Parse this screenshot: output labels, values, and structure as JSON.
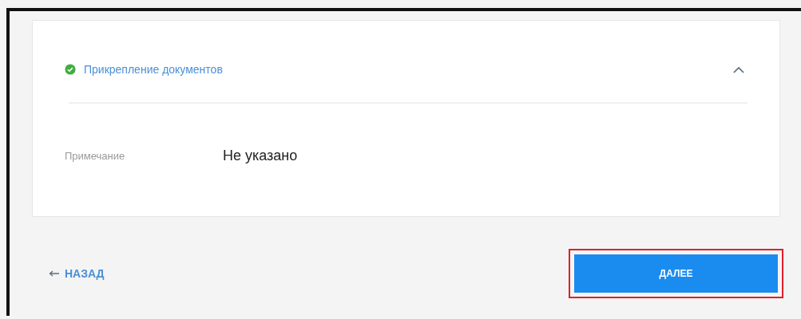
{
  "section": {
    "title": "Прикрепление документов",
    "completed": true,
    "expanded": true,
    "fields": [
      {
        "label": "Примечание",
        "value": "Не указано"
      }
    ]
  },
  "back_link": {
    "label": "НАЗАД"
  },
  "next_button": {
    "label": "ДАЛЕЕ",
    "highlighted": true
  }
}
